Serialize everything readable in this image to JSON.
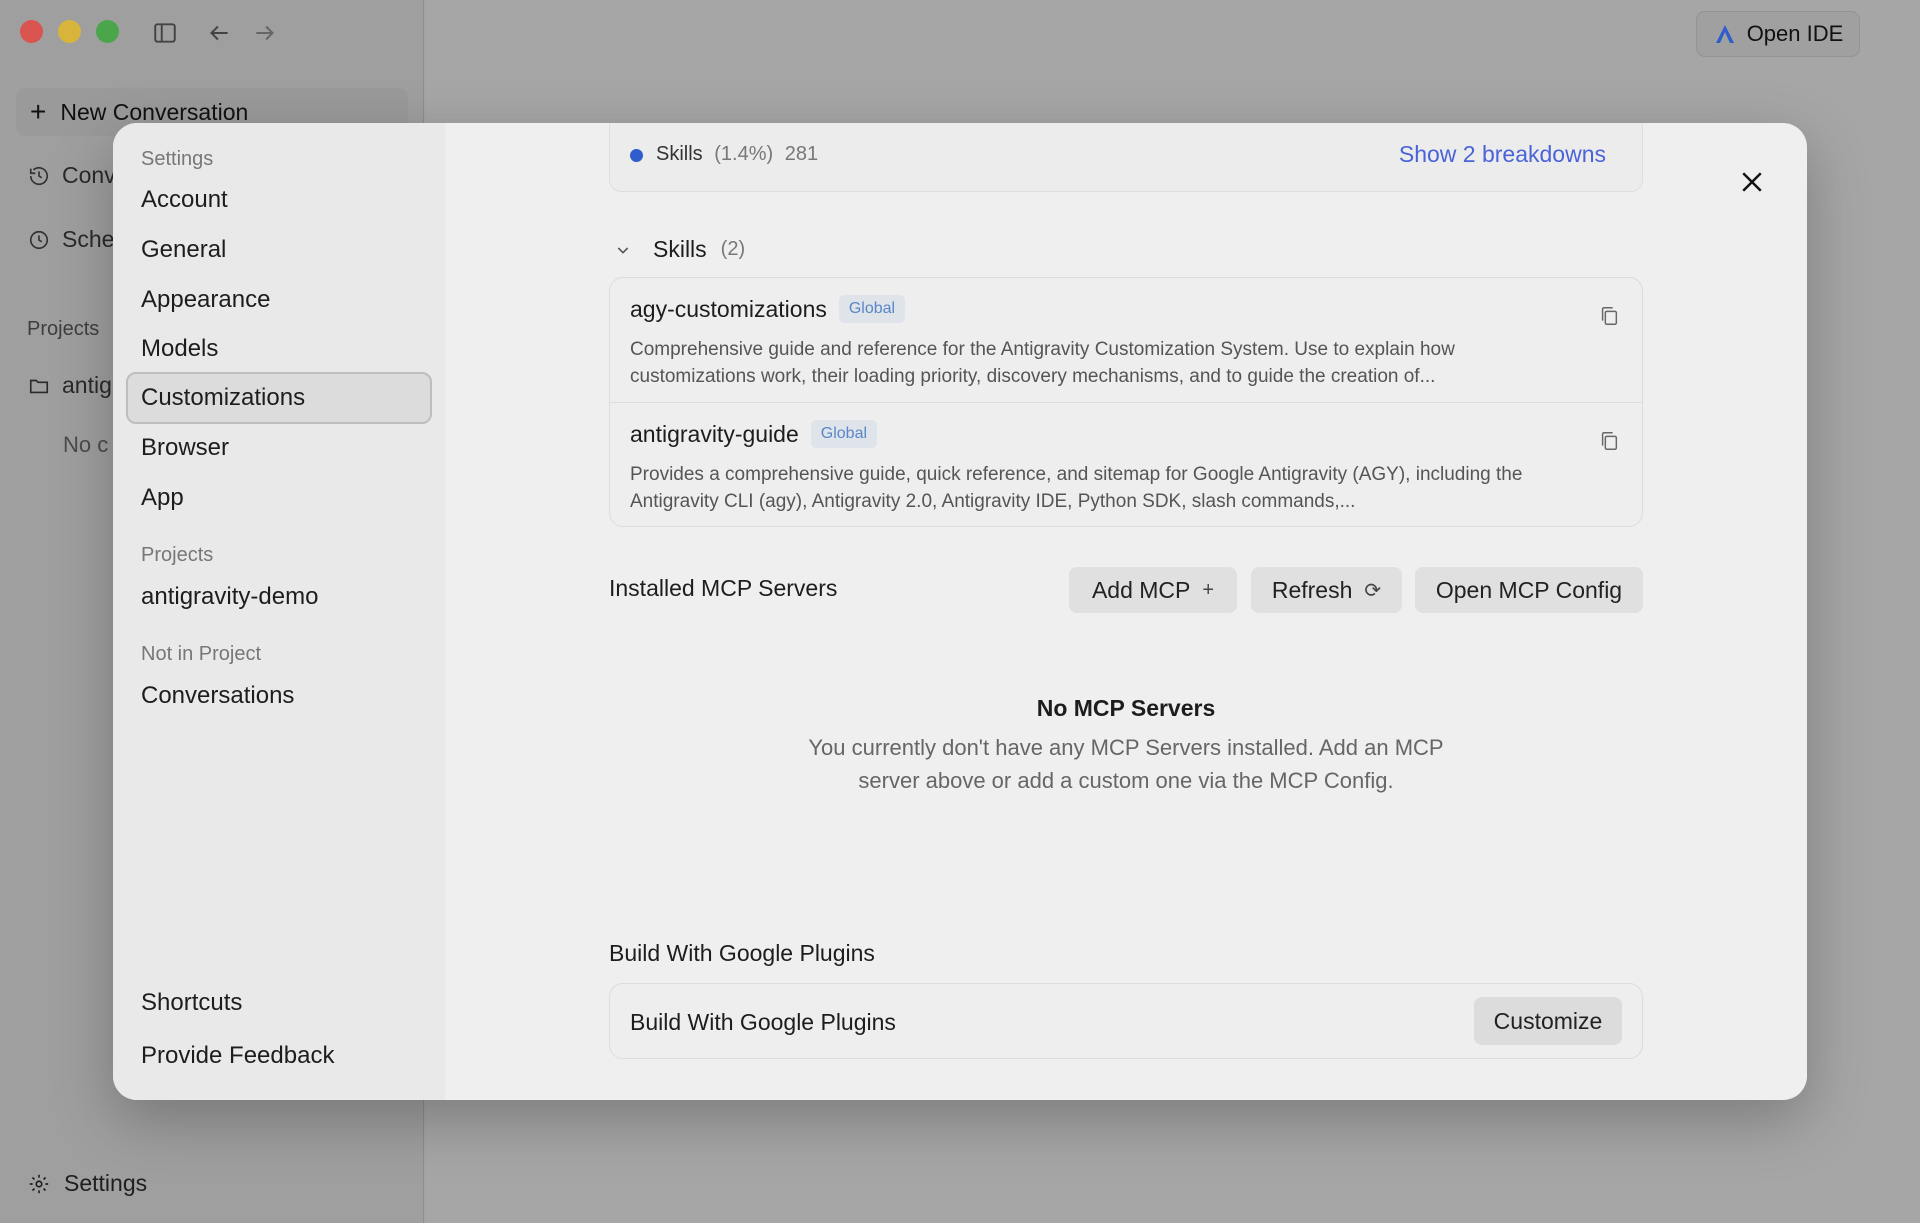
{
  "background": {
    "new_conversation": "New Conversation",
    "nav": [
      "Conv",
      "Sche"
    ],
    "projects_label": "Projects",
    "project_folder": "antig",
    "no_conversations": "No c",
    "settings": "Settings",
    "open_ide": "Open IDE"
  },
  "settings_nav": {
    "section_settings": "Settings",
    "items": [
      "Account",
      "General",
      "Appearance",
      "Models",
      "Customizations",
      "Browser",
      "App"
    ],
    "active": "Customizations",
    "section_projects": "Projects",
    "project": "antigravity-demo",
    "section_not_in_project": "Not in Project",
    "conversations": "Conversations",
    "shortcuts": "Shortcuts",
    "feedback": "Provide Feedback"
  },
  "breakdown": {
    "label": "Skills",
    "percent": "(1.4%)",
    "count": "281",
    "show_link": "Show 2 breakdowns",
    "dot_color": "#2f5ecc"
  },
  "skills": {
    "title": "Skills",
    "count": "(2)",
    "items": [
      {
        "name": "agy-customizations",
        "badge": "Global",
        "description": "Comprehensive guide and reference for the Antigravity Customization System. Use to explain how customizations work, their loading priority, discovery mechanisms, and to guide the creation of..."
      },
      {
        "name": "antigravity-guide",
        "badge": "Global",
        "description": "Provides a comprehensive guide, quick reference, and sitemap for Google Antigravity (AGY), including the Antigravity CLI (agy), Antigravity 2.0, Antigravity IDE, Python SDK, slash commands,..."
      }
    ]
  },
  "mcp": {
    "title": "Installed MCP Servers",
    "add_label": "Add MCP",
    "add_icon": "+",
    "refresh_label": "Refresh",
    "refresh_icon": "⟳",
    "config_label": "Open MCP Config",
    "empty_title": "No MCP Servers",
    "empty_description": "You currently don't have any MCP Servers installed. Add an MCP server above or add a custom one via the MCP Config."
  },
  "plugins": {
    "section_title": "Build With Google Plugins",
    "card_label": "Build With Google Plugins",
    "customize_label": "Customize"
  },
  "colors": {
    "accent_link": "#4a63d8",
    "badge_text": "#5a86c7"
  }
}
